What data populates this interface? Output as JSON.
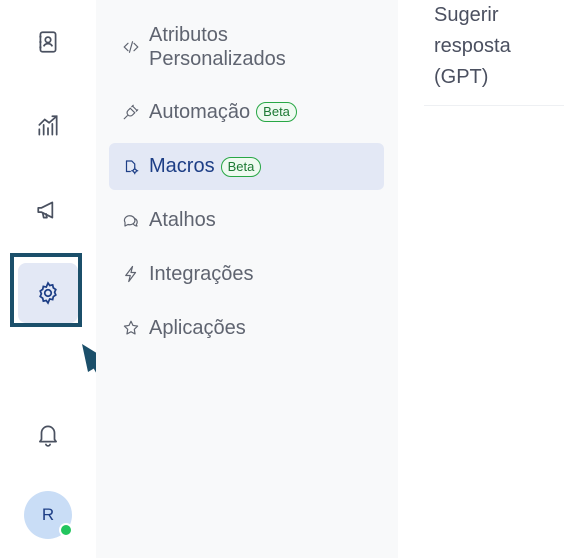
{
  "rail": {
    "items": [
      {
        "icon": "contact-book-icon"
      },
      {
        "icon": "reports-chart-icon"
      },
      {
        "icon": "megaphone-icon"
      },
      {
        "icon": "settings-gear-icon"
      },
      {
        "icon": "bell-icon"
      }
    ],
    "avatar_initial": "R",
    "status_color": "#22c55e"
  },
  "menu": {
    "items": [
      {
        "label": "Atributos Personalizados",
        "icon": "code-icon"
      },
      {
        "label": "Automação",
        "icon": "plug-icon",
        "badge": "Beta"
      },
      {
        "label": "Macros",
        "icon": "macro-icon",
        "badge": "Beta"
      },
      {
        "label": "Atalhos",
        "icon": "chat-bubbles-icon"
      },
      {
        "label": "Integrações",
        "icon": "lightning-icon"
      },
      {
        "label": "Aplicações",
        "icon": "star-icon"
      }
    ]
  },
  "content": {
    "gpt_label": "Sugerir resposta (GPT)"
  },
  "colors": {
    "accent": "#1d3e86",
    "active_bg": "#e3e8f5",
    "highlight": "#1b4f6a",
    "beta_green": "#28a745"
  }
}
